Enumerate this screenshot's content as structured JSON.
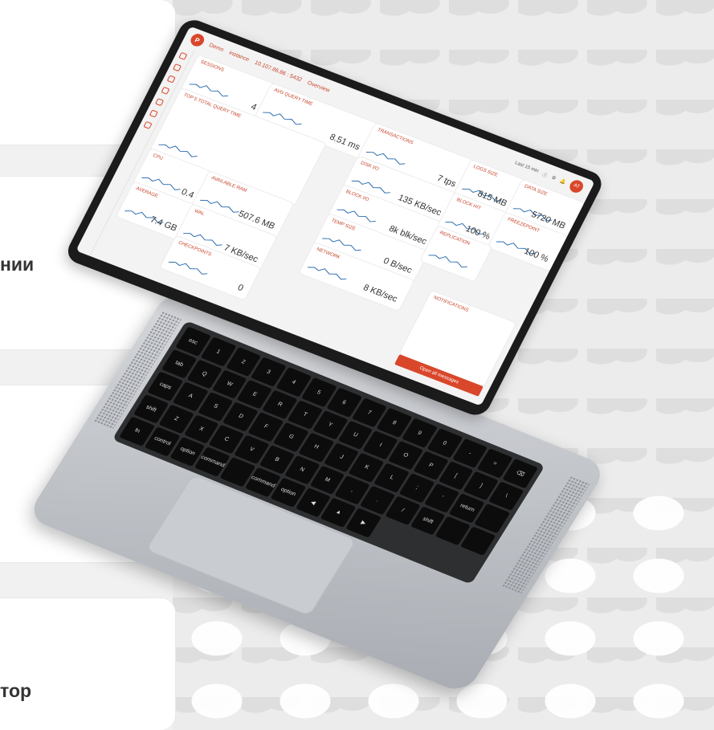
{
  "left_cards": [
    {
      "text": "нии"
    },
    {
      "text": "тор"
    }
  ],
  "dashboard": {
    "breadcrumb": [
      "Demo",
      "instance",
      "10.107.86.86 : 5432",
      "Overview"
    ],
    "topright": {
      "time_label": "Last 15 min",
      "avatar": "AT"
    },
    "tiles": [
      {
        "label": "SESSIONS",
        "value": "4"
      },
      {
        "label": "AVG QUERY TIME",
        "value": "8.51 ms"
      },
      {
        "label": "TOP 5 TOTAL QUERY TIME",
        "value": ""
      },
      {
        "label": "TRANSACTIONS",
        "value": "7 tps"
      },
      {
        "label": "DISK I/O",
        "value": "135 KB/sec"
      },
      {
        "label": "BLOCK I/O",
        "value": "8k blk/sec"
      },
      {
        "label": "TEMP SIZE",
        "value": "0 B/sec"
      },
      {
        "label": "NETWORK",
        "value": "8 KB/sec"
      },
      {
        "label": "CPU",
        "value": "0.4"
      },
      {
        "label": "AVERAGE",
        "value": "7.4 GB"
      },
      {
        "label": "AVAILABLE RAM",
        "value": "507.6 MB"
      },
      {
        "label": "WAL",
        "value": "7 KB/sec"
      },
      {
        "label": "LOGS SIZE",
        "value": "815 MB"
      },
      {
        "label": "DATA SIZE",
        "value": "5720 MB"
      },
      {
        "label": "BLOCK HIT",
        "value": "100 %"
      },
      {
        "label": "FREEZEPOINT",
        "value": "100 %"
      },
      {
        "label": "REPLICATION",
        "value": ""
      },
      {
        "label": "CHECKPOINTS",
        "value": "0"
      }
    ],
    "notification_label": "NOTIFICATIONS",
    "report_button": "Open all messages"
  },
  "keyboard": {
    "keys": [
      "esc",
      "1",
      "2",
      "3",
      "4",
      "5",
      "6",
      "7",
      "8",
      "9",
      "0",
      "-",
      "=",
      "⌫",
      "tab",
      "Q",
      "W",
      "E",
      "R",
      "T",
      "Y",
      "U",
      "I",
      "O",
      "P",
      "[",
      "]",
      "\\",
      "caps",
      "A",
      "S",
      "D",
      "F",
      "G",
      "H",
      "J",
      "K",
      "L",
      ";",
      "'",
      "return",
      "",
      "shift",
      "Z",
      "X",
      "C",
      "V",
      "B",
      "N",
      "M",
      ",",
      ".",
      "/",
      "shift",
      "",
      ""
    ],
    "bottom_row": [
      "fn",
      "control",
      "option",
      "command",
      "",
      "command",
      "option",
      "◀",
      "▲",
      "▶"
    ]
  }
}
